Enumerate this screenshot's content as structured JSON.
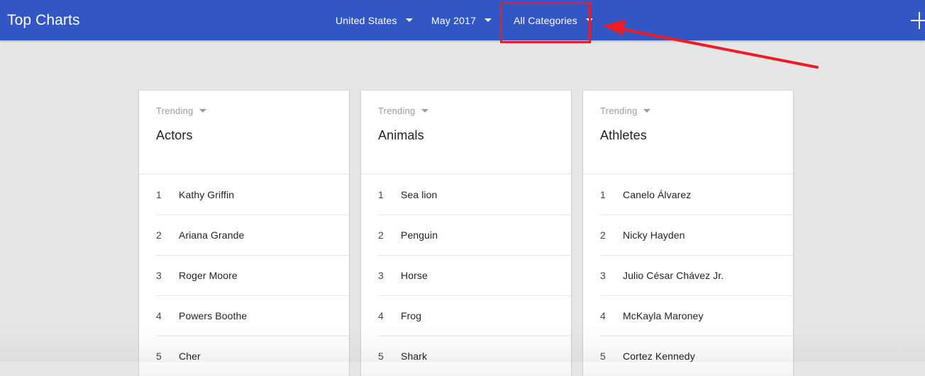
{
  "app_bar": {
    "title": "Top Charts",
    "filters": [
      {
        "name": "country",
        "label": "United States",
        "icon": "chevron-down-icon"
      },
      {
        "name": "date",
        "label": "May 2017",
        "icon": "chevron-down-icon"
      },
      {
        "name": "category",
        "label": "All Categories",
        "icon": "chevron-down-icon"
      }
    ],
    "add_button_icon": "plus-icon",
    "colors": {
      "bar_background": "#3257c4",
      "bar_text": "#ffffff"
    }
  },
  "annotation": {
    "highlight_target": "All Categories",
    "box_color": "#ee1c25",
    "arrow_color": "#ee1c25",
    "arrow_points_to": "All Categories"
  },
  "page": {
    "background": "#e6e6e6"
  },
  "cards": [
    {
      "menu_label": "Trending",
      "menu_icon": "chevron-down-icon",
      "title": "Actors",
      "entries": [
        {
          "rank": "1",
          "name": "Kathy Griffin"
        },
        {
          "rank": "2",
          "name": "Ariana Grande"
        },
        {
          "rank": "3",
          "name": "Roger Moore"
        },
        {
          "rank": "4",
          "name": "Powers Boothe"
        },
        {
          "rank": "5",
          "name": "Cher"
        }
      ]
    },
    {
      "menu_label": "Trending",
      "menu_icon": "chevron-down-icon",
      "title": "Animals",
      "entries": [
        {
          "rank": "1",
          "name": "Sea lion"
        },
        {
          "rank": "2",
          "name": "Penguin"
        },
        {
          "rank": "3",
          "name": "Horse"
        },
        {
          "rank": "4",
          "name": "Frog"
        },
        {
          "rank": "5",
          "name": "Shark"
        }
      ]
    },
    {
      "menu_label": "Trending",
      "menu_icon": "chevron-down-icon",
      "title": "Athletes",
      "entries": [
        {
          "rank": "1",
          "name": "Canelo Álvarez"
        },
        {
          "rank": "2",
          "name": "Nicky Hayden"
        },
        {
          "rank": "3",
          "name": "Julio César Chávez Jr."
        },
        {
          "rank": "4",
          "name": "McKayla Maroney"
        },
        {
          "rank": "5",
          "name": "Cortez Kennedy"
        }
      ]
    }
  ]
}
